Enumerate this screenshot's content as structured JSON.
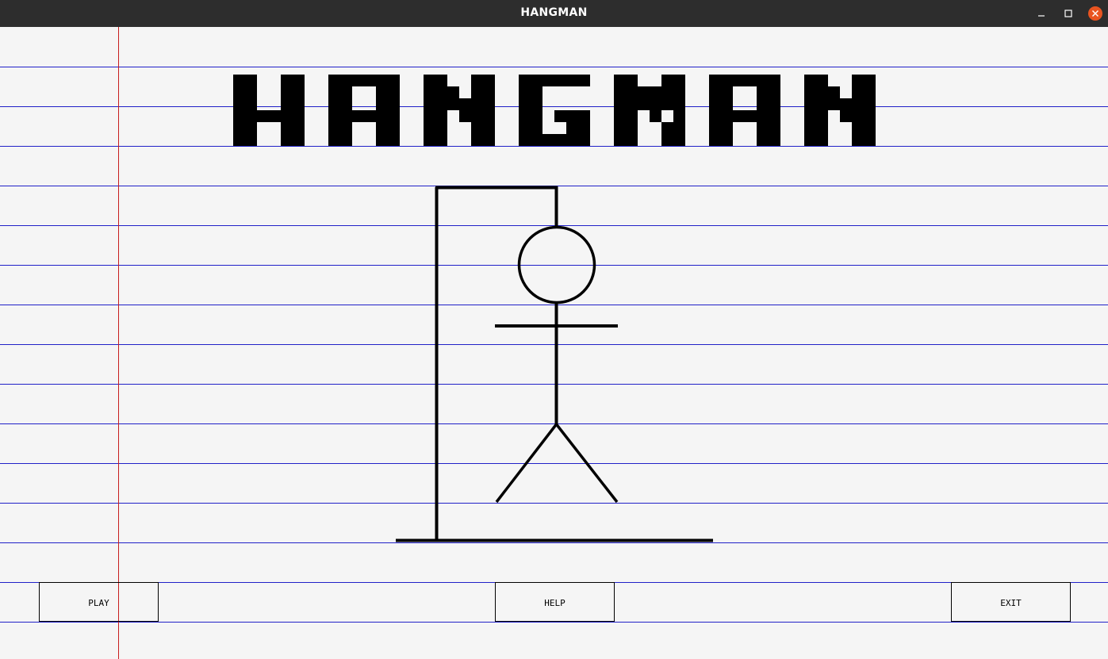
{
  "window": {
    "title": "HANGMAN",
    "controls": [
      "minimize",
      "maximize",
      "close"
    ],
    "close_color": "#e95420"
  },
  "game": {
    "logo_text": "HANGMAN",
    "colors": {
      "paper": "#f5f5f5",
      "ruled_line": "#2020c8",
      "margin_line": "#c81e1e",
      "ink": "#000000"
    },
    "figure_parts": [
      "gallows-base",
      "gallows-post",
      "gallows-beam",
      "rope",
      "head",
      "body",
      "arms",
      "left-leg",
      "right-leg"
    ]
  },
  "menu": {
    "play_label": "PLAY",
    "help_label": "HELP",
    "exit_label": "EXIT"
  }
}
